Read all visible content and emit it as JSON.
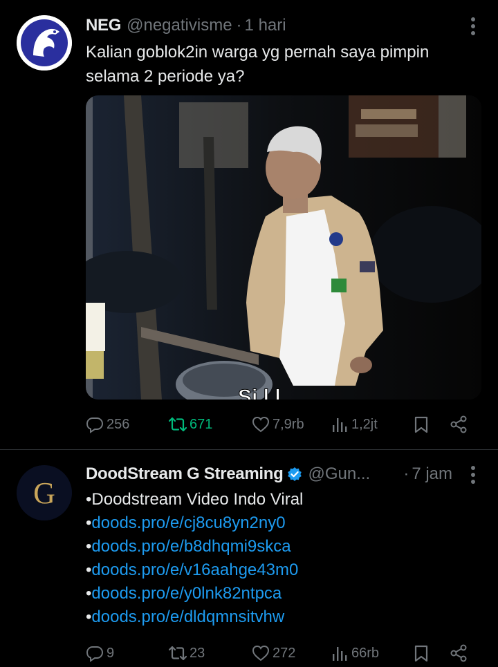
{
  "tweets": [
    {
      "name": "NEG",
      "handle": "@negativisme",
      "dot": "·",
      "time": "1 hari",
      "text_lines": [
        "Kalian goblok2in warga yg pernah saya pimpin",
        "selama 2 periode ya?"
      ],
      "stats": {
        "replies": "256",
        "retweets": "671",
        "likes": "7,9rb",
        "views": "1,2jt"
      }
    },
    {
      "name": "DoodStream G Streaming",
      "handle": "@Gun...",
      "dot": "·",
      "time": "7 jam",
      "avatar_letter": "G",
      "text_lines": [
        "•Doodstream Video Indo Viral"
      ],
      "links": [
        {
          "bullet": "•",
          "url": "doods.pro/e/cj8cu8yn2ny0"
        },
        {
          "bullet": "•",
          "url": "doods.pro/e/b8dhqmi9skca"
        },
        {
          "bullet": "•",
          "url": "doods.pro/e/v16aahge43m0"
        },
        {
          "bullet": "•",
          "url": "doods.pro/e/y0lnk82ntpca"
        },
        {
          "bullet": "•",
          "url": "doods.pro/e/dldqmnsitvhw"
        }
      ],
      "stats": {
        "replies": "9",
        "retweets": "23",
        "likes": "272",
        "views": "66rb"
      }
    }
  ],
  "colors": {
    "background": "#000000",
    "text": "#e7e9ea",
    "muted": "#71767b",
    "link": "#1d9bf0",
    "retweet_active": "#00ba7c",
    "verified": "#1d9bf0"
  },
  "icons": {
    "reply": "reply-icon",
    "retweet": "retweet-icon",
    "like": "heart-icon",
    "views": "views-icon",
    "bookmark": "bookmark-icon",
    "share": "share-icon",
    "more": "more-vertical-icon"
  }
}
